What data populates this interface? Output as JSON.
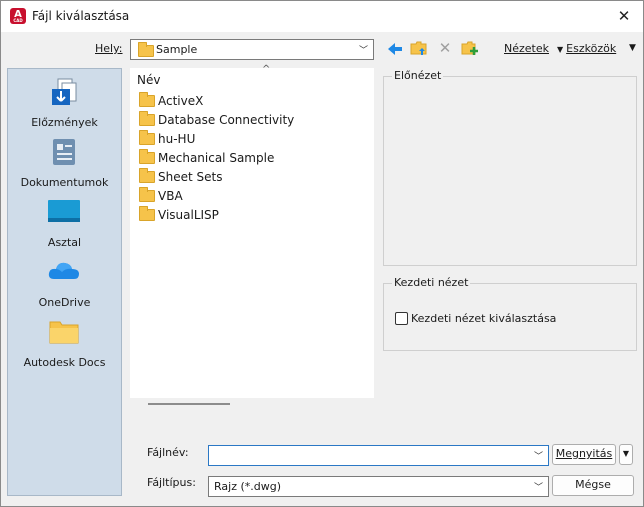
{
  "window": {
    "title": "Fájl kiválasztása",
    "app_icon_letter": "A",
    "app_icon_sub": "CAD",
    "close_glyph": "✕"
  },
  "location": {
    "label": "Hely:",
    "value": "Sample"
  },
  "toolbar": {
    "back_glyph": "🡄",
    "delete_glyph": "✕",
    "views_label": "Nézetek",
    "tools_label": "Eszközök",
    "more_glyph": "▼"
  },
  "places": [
    {
      "label": "Előzmények",
      "icon": "history-icon"
    },
    {
      "label": "Dokumentumok",
      "icon": "documents-icon"
    },
    {
      "label": "Asztal",
      "icon": "desktop-icon"
    },
    {
      "label": "OneDrive",
      "icon": "onedrive-icon"
    },
    {
      "label": "Autodesk Docs",
      "icon": "folder-icon"
    }
  ],
  "file_list": {
    "column_header": "Név",
    "sort_glyph": "^",
    "items": [
      "ActiveX",
      "Database Connectivity",
      "hu-HU",
      "Mechanical Sample",
      "Sheet Sets",
      "VBA",
      "VisualLISP"
    ]
  },
  "preview": {
    "label": "Előnézet"
  },
  "initial_view": {
    "group_label": "Kezdeti nézet",
    "checkbox_label": "Kezdeti nézet kiválasztása",
    "checked": false
  },
  "filename": {
    "label": "Fájlnév:",
    "value": "",
    "open_button": "Megnyitás",
    "open_arrow": "▼"
  },
  "filetype": {
    "label": "Fájltípus:",
    "value": "Rajz (*.dwg)",
    "cancel_button": "Mégse"
  },
  "colors": {
    "accent_blue": "#1e88e5",
    "folder_yellow": "#f6c34a",
    "places_bg": "#cfdce9",
    "app_red": "#c8102e"
  }
}
